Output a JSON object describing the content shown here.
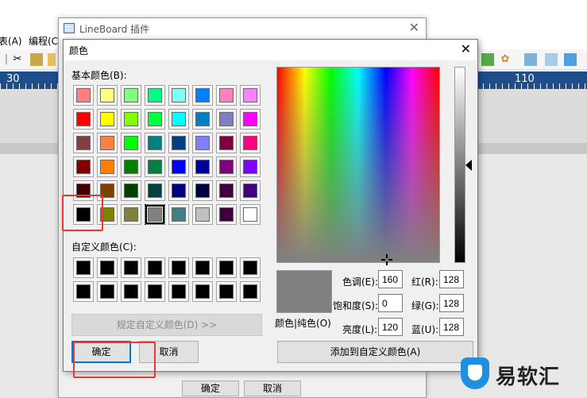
{
  "background_app": {
    "menus": [
      "表(A)",
      "编程(C)"
    ],
    "ruler": {
      "left_number": "30",
      "right_number": "110"
    }
  },
  "plugin_window": {
    "title": "LineBoard 插件",
    "ok_label": "确定",
    "cancel_label": "取消",
    "close_glyph": "✕"
  },
  "color_dialog": {
    "title": "颜色",
    "close_glyph": "✕",
    "basic_colors_label": "基本颜色(B):",
    "custom_colors_label": "自定义颜色(C):",
    "basic_colors": [
      "#ff8080",
      "#ffff80",
      "#80ff80",
      "#00ff80",
      "#80ffff",
      "#0080ff",
      "#ff80c0",
      "#ff80ff",
      "#ff0000",
      "#ffff00",
      "#80ff00",
      "#00ff40",
      "#00ffff",
      "#0080c0",
      "#8080c0",
      "#ff00ff",
      "#804040",
      "#ff8040",
      "#00ff00",
      "#008080",
      "#004080",
      "#8080ff",
      "#800040",
      "#ff0080",
      "#800000",
      "#ff8000",
      "#008000",
      "#008040",
      "#0000ff",
      "#0000a0",
      "#800080",
      "#8000ff",
      "#400000",
      "#804000",
      "#004000",
      "#004040",
      "#000080",
      "#000040",
      "#400040",
      "#400080",
      "#000000",
      "#808000",
      "#808040",
      "#808080",
      "#408080",
      "#c0c0c0",
      "#400040",
      "#ffffff"
    ],
    "selected_basic_index": 43,
    "custom_colors": [
      "#000000",
      "#000000",
      "#000000",
      "#000000",
      "#000000",
      "#000000",
      "#000000",
      "#000000",
      "#000000",
      "#000000",
      "#000000",
      "#000000",
      "#000000",
      "#000000",
      "#000000",
      "#000000"
    ],
    "define_custom_button": "规定自定义颜色(D) >>",
    "ok_button": "确定",
    "cancel_button": "取消",
    "color_solid_label": "颜色|纯色(O)",
    "hue_label": "色调(E):",
    "hue_value": "160",
    "sat_label": "饱和度(S):",
    "sat_value": "0",
    "lum_label": "亮度(L):",
    "lum_value": "120",
    "red_label": "红(R):",
    "red_value": "128",
    "green_label": "绿(G):",
    "green_value": "128",
    "blue_label": "蓝(U):",
    "blue_value": "128",
    "add_custom_button": "添加到自定义颜色(A)",
    "preview_color": "#808080"
  },
  "annotation_color": "#e53935",
  "watermark": {
    "text": "易软汇"
  }
}
